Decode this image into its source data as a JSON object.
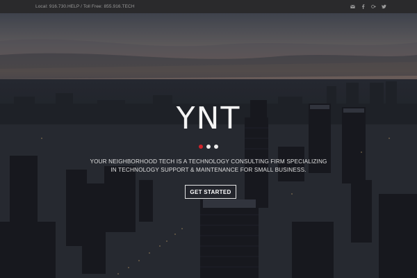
{
  "topbar": {
    "contact": "Local: 916.730.HELP / Toll Free: 855.916.TECH",
    "social": [
      "mail-icon",
      "facebook-icon",
      "google-plus-icon",
      "twitter-icon"
    ]
  },
  "hero": {
    "brand": "YNT",
    "slider_dots": 3,
    "active_dot": 0,
    "tagline_line1": "YOUR NEIGHBORHOOD TECH IS A TECHNOLOGY CONSULTING FIRM SPECIALIZING",
    "tagline_line2": "IN TECHNOLOGY SUPPORT & MAINTENANCE FOR SMALL BUSINESS.",
    "cta_label": "GET STARTED"
  },
  "colors": {
    "topbar_bg": "#2a2a2c",
    "accent_red": "#d2232a",
    "text_light": "#f4f4f4"
  }
}
